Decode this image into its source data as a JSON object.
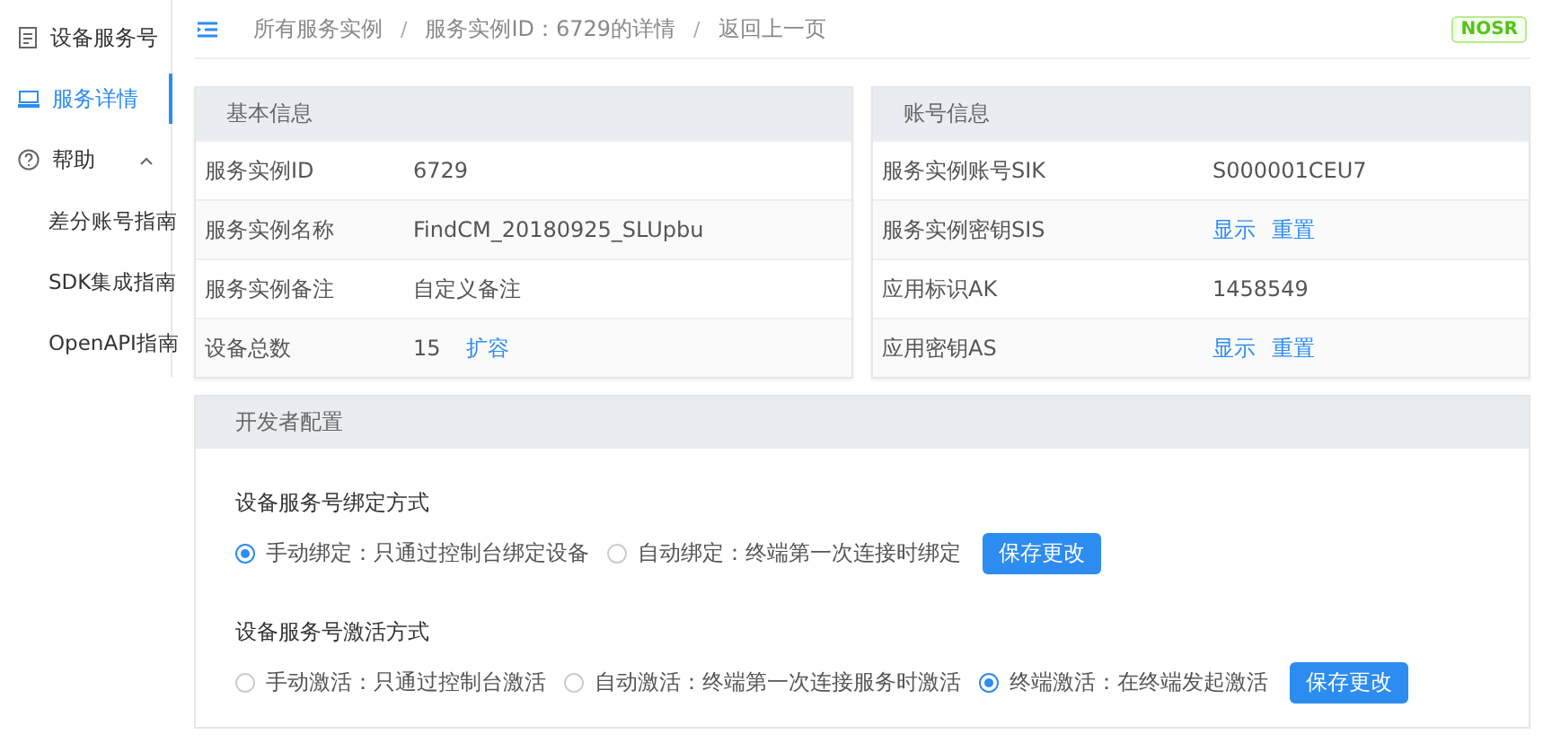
{
  "sidebar": {
    "items": [
      {
        "label": "设备服务号",
        "selected": false
      },
      {
        "label": "服务详情",
        "selected": true
      },
      {
        "label": "帮助",
        "selected": false,
        "expanded": true,
        "children": [
          {
            "label": "差分账号指南",
            "selected": false
          },
          {
            "label": "SDK集成指南",
            "selected": false
          },
          {
            "label": "OpenAPI指南",
            "selected": false
          }
        ]
      }
    ]
  },
  "breadcrumb": [
    {
      "kind": "link",
      "text": "所有服务实例"
    },
    {
      "kind": "separator",
      "text": "/"
    },
    {
      "kind": "link",
      "text": "服务实例ID：6729的详情"
    },
    {
      "kind": "separator",
      "text": "/"
    },
    {
      "kind": "link",
      "text": "返回上一页"
    }
  ],
  "tag": "NOSR",
  "panels": [
    {
      "title": "基本信息",
      "rows": [
        {
          "label": "服务实例ID",
          "value": "6729"
        },
        {
          "label": "服务实例名称",
          "value": "FindCM_20180925_SLUpbu"
        },
        {
          "label": "服务实例备注",
          "value": "自定义备注"
        },
        {
          "label": "设备总数",
          "value": "15",
          "links": [
            "扩容"
          ]
        }
      ]
    },
    {
      "title": "账号信息",
      "rows": [
        {
          "label": "服务实例账号SIK",
          "value": "S000001CEU7"
        },
        {
          "label": "服务实例密钥SIS",
          "links": [
            "显示",
            "重置"
          ]
        },
        {
          "label": "应用标识AK",
          "value": "1458549"
        },
        {
          "label": "应用密钥AS",
          "links": [
            "显示",
            "重置"
          ]
        }
      ]
    }
  ],
  "developer": {
    "title": "开发者配置",
    "groups": [
      {
        "title": "设备服务号绑定方式",
        "options": [
          {
            "label": "手动绑定：只通过控制台绑定设备",
            "selected": true
          },
          {
            "label": "自动绑定：终端第一次连接时绑定",
            "selected": false
          }
        ],
        "button": "保存更改"
      },
      {
        "title": "设备服务号激活方式",
        "options": [
          {
            "label": "手动激活：只通过控制台激活",
            "selected": false
          },
          {
            "label": "自动激活：终端第一次连接服务时激活",
            "selected": false
          },
          {
            "label": "终端激活：在终端发起激活",
            "selected": true
          }
        ],
        "button": "保存更改"
      }
    ]
  }
}
